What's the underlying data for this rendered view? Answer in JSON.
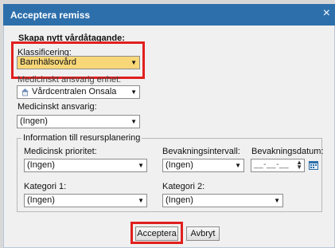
{
  "dialog": {
    "title": "Acceptera remiss",
    "close_icon": "×"
  },
  "section": {
    "heading": "Skapa nytt vårdåtagande:"
  },
  "klassificering": {
    "label": "Klassificering:",
    "value": "Barnhälsovård"
  },
  "enhet": {
    "label": "Medicinskt ansvarig enhet:",
    "value": "Vårdcentralen Onsala",
    "icon": "house-icon"
  },
  "ansvarig": {
    "label": "Medicinskt ansvarig:",
    "value": "(Ingen)"
  },
  "resurs": {
    "legend": "Information till resursplanering",
    "prioritet_label": "Medicinsk prioritet:",
    "prioritet_value": "(Ingen)",
    "intervall_label": "Bevakningsintervall:",
    "intervall_value": "(Ingen)",
    "datum_label": "Bevakningsdatum:",
    "datum_value": "__-__-__",
    "kategori1_label": "Kategori 1:",
    "kategori1_value": "(Ingen)",
    "kategori2_label": "Kategori 2:",
    "kategori2_value": "(Ingen)"
  },
  "buttons": {
    "accept": "Acceptera",
    "cancel": "Avbryt"
  },
  "colors": {
    "titlebar": "#2d6fab",
    "highlight": "#e0201f",
    "selected_field": "#f8d778"
  }
}
